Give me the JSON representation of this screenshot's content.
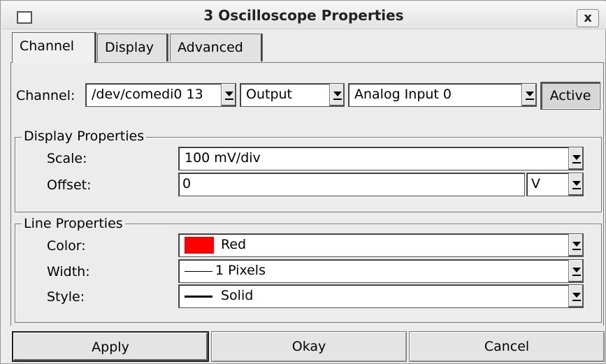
{
  "window": {
    "title": "3 Oscilloscope Properties",
    "close_label": "x"
  },
  "tabs": [
    {
      "label": "Channel",
      "active": true
    },
    {
      "label": "Display",
      "active": false
    },
    {
      "label": "Advanced",
      "active": false
    }
  ],
  "channel_row": {
    "label": "Channel:",
    "device": "/dev/comedi0 13",
    "direction": "Output",
    "channel": "Analog Input 0",
    "active_label": "Active"
  },
  "display_properties": {
    "title": "Display Properties",
    "scale_label": "Scale:",
    "scale_value": "100 mV/div",
    "offset_label": "Offset:",
    "offset_value": "0",
    "offset_unit": "V"
  },
  "line_properties": {
    "title": "Line Properties",
    "color_label": "Color:",
    "color_value": "Red",
    "color_hex": "#ff0000",
    "width_label": "Width:",
    "width_value": "1 Pixels",
    "style_label": "Style:",
    "style_value": "Solid"
  },
  "buttons": {
    "apply": "Apply",
    "okay": "Okay",
    "cancel": "Cancel"
  }
}
